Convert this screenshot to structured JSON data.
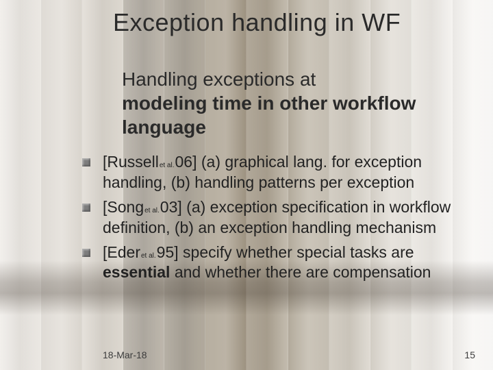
{
  "title": "Exception handling in WF",
  "subtitle": {
    "line1": "Handling exceptions at",
    "line2_bold": "modeling time in other workflow language"
  },
  "bullets": [
    {
      "author": "Russell",
      "etal": "et al.",
      "year_close": "06]",
      "rest": " (a) graphical lang. for exception handling, (b) handling patterns per exception"
    },
    {
      "author": "Song",
      "etal": "et al.",
      "year_close": "03]",
      "rest": " (a) exception specification in workflow definition,  (b) an exception handling mechanism"
    },
    {
      "author": "Eder",
      "etal": "et al.",
      "year_close": "95]",
      "rest_pre": " specify whether special tasks are ",
      "rest_bold": "essential",
      "rest_post": " and whether there are compensation"
    }
  ],
  "footer": {
    "date": "18-Mar-18",
    "page": "15"
  }
}
